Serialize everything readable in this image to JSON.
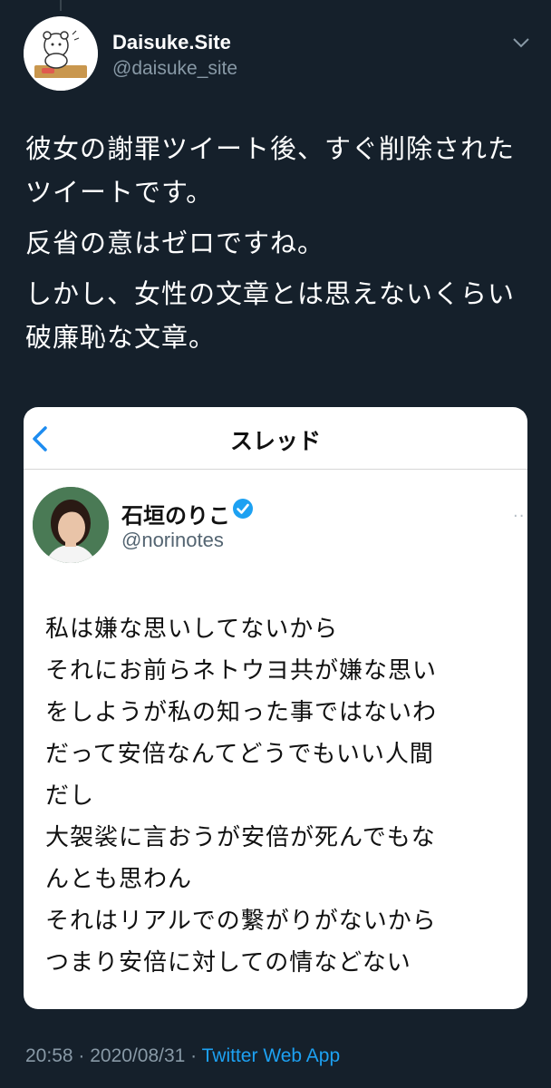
{
  "author": {
    "display_name": "Daisuke.Site",
    "handle": "@daisuke_site"
  },
  "tweet": {
    "paragraphs": [
      "彼女の謝罪ツイート後、すぐ削除されたツイートです。",
      "反省の意はゼロですね。",
      "しかし、女性の文章とは思えないくらい破廉恥な文章。"
    ]
  },
  "embedded_screenshot": {
    "nav_title": "スレッド",
    "name": "石垣のりこ",
    "handle": "@norinotes",
    "lines": [
      "私は嫌な思いしてないから",
      "それにお前らネトウヨ共が嫌な思い",
      "をしようが私の知った事ではないわ",
      "だって安倍なんてどうでもいい人間",
      "だし",
      "大袈裟に言おうが安倍が死んでもな",
      "んとも思わん",
      "それはリアルでの繋がりがないから",
      "つまり安倍に対しての情などない"
    ]
  },
  "footer": {
    "time": "20:58",
    "separator": " · ",
    "date": "2020/08/31",
    "separator2": " · ",
    "source": "Twitter Web App"
  },
  "colors": {
    "background": "#15202b",
    "secondary_text": "#8899a6",
    "link": "#1da1f2",
    "verified_badge": "#1da1f2"
  },
  "icons": {
    "caret": "chevron-down-icon",
    "back": "chevron-left-icon",
    "verified": "verified-badge-icon"
  }
}
